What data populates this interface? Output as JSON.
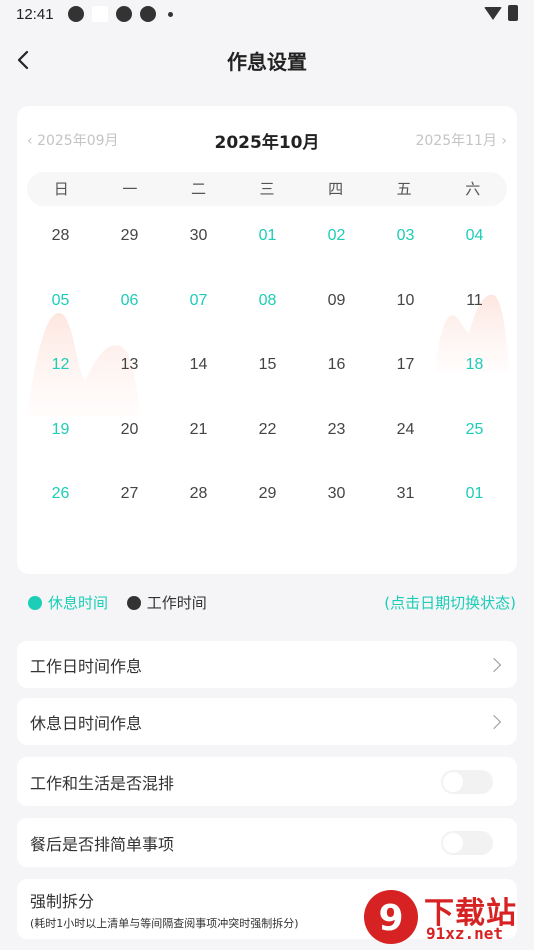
{
  "status_bar": {
    "time": "12:41"
  },
  "header": {
    "title": "作息设置",
    "back_icon": "chevron-left-icon"
  },
  "calendar": {
    "prev_month": "2025年09月",
    "current_month": "2025年10月",
    "next_month": "2025年11月",
    "weekdays": [
      "日",
      "一",
      "二",
      "三",
      "四",
      "五",
      "六"
    ],
    "weeks": [
      [
        {
          "d": "28",
          "rest": false
        },
        {
          "d": "29",
          "rest": false
        },
        {
          "d": "30",
          "rest": false
        },
        {
          "d": "01",
          "rest": true
        },
        {
          "d": "02",
          "rest": true
        },
        {
          "d": "03",
          "rest": true
        },
        {
          "d": "04",
          "rest": true
        }
      ],
      [
        {
          "d": "05",
          "rest": true
        },
        {
          "d": "06",
          "rest": true
        },
        {
          "d": "07",
          "rest": true
        },
        {
          "d": "08",
          "rest": true
        },
        {
          "d": "09",
          "rest": false
        },
        {
          "d": "10",
          "rest": false
        },
        {
          "d": "11",
          "rest": false
        }
      ],
      [
        {
          "d": "12",
          "rest": true
        },
        {
          "d": "13",
          "rest": false
        },
        {
          "d": "14",
          "rest": false
        },
        {
          "d": "15",
          "rest": false
        },
        {
          "d": "16",
          "rest": false
        },
        {
          "d": "17",
          "rest": false
        },
        {
          "d": "18",
          "rest": true
        }
      ],
      [
        {
          "d": "19",
          "rest": true
        },
        {
          "d": "20",
          "rest": false
        },
        {
          "d": "21",
          "rest": false
        },
        {
          "d": "22",
          "rest": false
        },
        {
          "d": "23",
          "rest": false
        },
        {
          "d": "24",
          "rest": false
        },
        {
          "d": "25",
          "rest": true
        }
      ],
      [
        {
          "d": "26",
          "rest": true
        },
        {
          "d": "27",
          "rest": false
        },
        {
          "d": "28",
          "rest": false
        },
        {
          "d": "29",
          "rest": false
        },
        {
          "d": "30",
          "rest": false
        },
        {
          "d": "31",
          "rest": false
        },
        {
          "d": "01",
          "rest": true
        }
      ]
    ]
  },
  "legend": {
    "rest_label": "休息时间",
    "work_label": "工作时间",
    "hint": "(点击日期切换状态)",
    "rest_color": "#1ccdb7",
    "work_color": "#333333"
  },
  "settings": {
    "workday_label": "工作日时间作息",
    "restday_label": "休息日时间作息",
    "mix_label": "工作和生活是否混排",
    "mix_enabled": false,
    "meal_label": "餐后是否排简单事项",
    "meal_enabled": false,
    "split_label": "强制拆分",
    "split_desc": "(耗时1小时以上清单与等间隔查阅事项冲突时强制拆分)"
  },
  "watermark": {
    "title": "下载站",
    "url": "91xz.net",
    "mark": "9"
  }
}
